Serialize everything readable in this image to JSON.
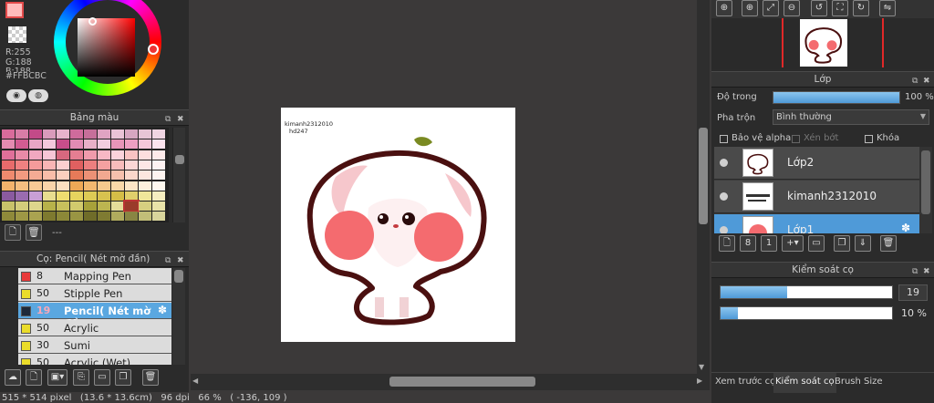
{
  "color_panel": {
    "r_label": "R:255",
    "g_label": "G:188",
    "b_label": "B:188",
    "hex": "#FFBCBC",
    "color": "#ffbcbc"
  },
  "palette_panel": {
    "title": "Bảng màu",
    "dash": "---",
    "colors": [
      [
        "#d96b9b",
        "#d87da6",
        "#c34a88",
        "#d99bbb",
        "#e7b3cc",
        "#cf6b9c",
        "#c66f9a",
        "#e0a3c2",
        "#eac3d6",
        "#d7a6c1",
        "#e7c5d6",
        "#f0d5e2"
      ],
      [
        "#e38bb0",
        "#d25c92",
        "#e9a6c5",
        "#f3c8dc",
        "#c84e8a",
        "#e28cb4",
        "#e8b0c8",
        "#f2cde0",
        "#e895b9",
        "#ee9fc3",
        "#f4c7da",
        "#fbe3ee"
      ],
      [
        "#e0709a",
        "#e98ba8",
        "#f1a8c0",
        "#f7c6d6",
        "#d7687f",
        "#e57e92",
        "#f09bac",
        "#f7b8c5",
        "#fbd3dc",
        "#f9c3c3",
        "#fcdede",
        "#fdeaea"
      ],
      [
        "#e86b6b",
        "#f08181",
        "#f49b9b",
        "#f8b5b5",
        "#fbd0d0",
        "#e06060",
        "#ed7f7f",
        "#f4a0a0",
        "#f8bcbc",
        "#fbd6d6",
        "#fde6e6",
        "#fef2f2"
      ],
      [
        "#ef8a6e",
        "#f29a80",
        "#f5ab94",
        "#f8bda9",
        "#fbcfbe",
        "#e77a59",
        "#ec9176",
        "#f2a890",
        "#f6c0ad",
        "#fad7cb",
        "#fde6df",
        "#fef4f0"
      ],
      [
        "#f3b36c",
        "#f5be80",
        "#f7c995",
        "#f9d4aa",
        "#fbdfc0",
        "#eea856",
        "#f2b870",
        "#f6c98d",
        "#f9d8a9",
        "#fce6c7",
        "#fdf0de",
        "#fef8ef"
      ],
      [
        "#8a5aa0",
        "#9a6cb0",
        "#c99fd6",
        "#e8dd8f",
        "#eedd70",
        "#e6d45e",
        "#ddcb55",
        "#d7c24f",
        "#d4bd47",
        "#e0cf6b",
        "#f0e69a",
        "#f6eec0"
      ],
      [
        "#c8c26a",
        "#d3cc7b",
        "#ddd68c",
        "#b7b24a",
        "#c8c05c",
        "#d2ca6d",
        "#a7a13a",
        "#bcb550",
        "#e5de9a",
        "#9a3b2a",
        "#d6cf80",
        "#e9e3a8"
      ],
      [
        "#8f8a3a",
        "#9e9845",
        "#aaa350",
        "#7e7a2f",
        "#8c8838",
        "#999543",
        "#6f6c29",
        "#7f7b32",
        "#b0ab5d",
        "#898543",
        "#c2be78",
        "#d9d59c"
      ]
    ]
  },
  "brush_panel": {
    "title": "Cọ: Pencil( Nét mờ đần)",
    "brushes": [
      {
        "size": "8",
        "name": "Mapping Pen",
        "color": "#e8393a"
      },
      {
        "size": "50",
        "name": "Stipple Pen",
        "color": "#eadc2a"
      },
      {
        "size": "19",
        "name": "Pencil( Nét mờ đần",
        "color": "#1e2a3a"
      },
      {
        "size": "50",
        "name": "Acrylic",
        "color": "#eadc2a"
      },
      {
        "size": "30",
        "name": "Sumi",
        "color": "#eadc2a"
      },
      {
        "size": "50",
        "name": "Acrylic (Wet)",
        "color": "#eadc2a"
      }
    ]
  },
  "status_bar": {
    "text": "515 * 514 pixel   (13.6 * 13.6cm)   96 dpi   66 %   ( -136, 109 )"
  },
  "canvas": {
    "watermark_line1": "kimanh2312010",
    "watermark_line2": "hd247"
  },
  "layer_panel": {
    "title": "Lớp",
    "opacity_label": "Độ trong",
    "opacity_value": "100 %",
    "opacity_fraction": 1.0,
    "blend_label": "Pha trộn",
    "blend_value": "Bình thường",
    "protect_alpha": "Bảo vệ alpha",
    "clipping": "Xén bớt",
    "lock": "Khóa",
    "layers": [
      {
        "name": "Lớp2"
      },
      {
        "name": "kimanh2312010"
      },
      {
        "name": "Lớp1"
      }
    ]
  },
  "brush_control": {
    "title": "Kiểm soát cọ",
    "size_value": "19",
    "size_fraction": 0.39,
    "opacity_value": "10 %",
    "opacity_fraction": 0.1
  },
  "bottom_tabs": [
    "Xem trước cọ",
    "Kiểm soát cọ",
    "Brush Size"
  ],
  "accent": "#5aa7e0"
}
